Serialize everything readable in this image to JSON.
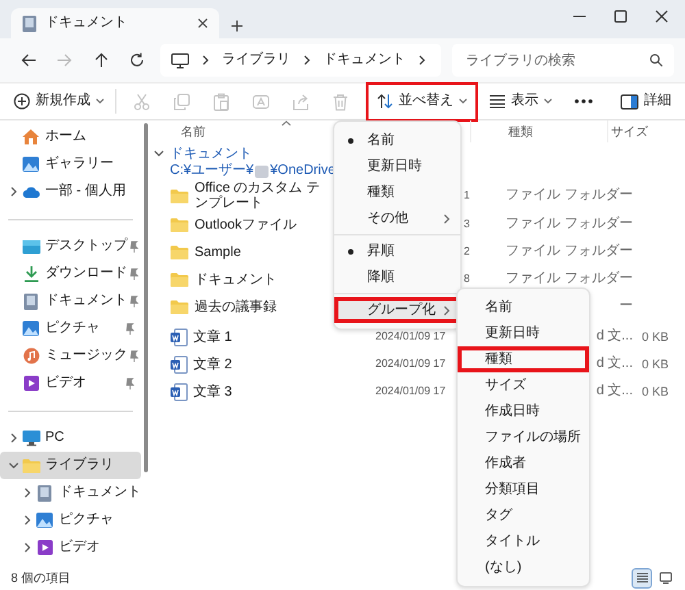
{
  "window": {
    "tab_title": "ドキュメント"
  },
  "navigation": [
    {
      "disabled": false
    },
    {
      "disabled": true
    },
    {
      "disabled": false
    },
    {
      "disabled": false
    }
  ],
  "address": {
    "segments": [
      "ライブラリ",
      "ドキュメント"
    ]
  },
  "search": {
    "placeholder": "ライブラリの検索"
  },
  "toolbar": {
    "new_label": "新規作成",
    "edit_actions": [
      {
        "disabled": true
      },
      {
        "disabled": true
      },
      {
        "disabled": true
      },
      {
        "disabled": true
      },
      {
        "disabled": true
      },
      {
        "disabled": true
      }
    ],
    "sort": {
      "label": "並べ替え",
      "highlighted": true
    },
    "view_label": "表示",
    "details_label": "詳細"
  },
  "sidebar": {
    "sections": [
      [
        {
          "label": "ホーム",
          "selected": false
        },
        {
          "label": "ギャラリー",
          "selected": false
        },
        {
          "label": "一部 - 個人用",
          "selected": false,
          "expanded": false
        }
      ],
      [
        {
          "label": "デスクトップ",
          "selected": false,
          "pinned": true
        },
        {
          "label": "ダウンロード",
          "selected": false,
          "pinned": true
        },
        {
          "label": "ドキュメント",
          "selected": false,
          "pinned": true
        },
        {
          "label": "ピクチャ",
          "selected": false,
          "pinned": true
        },
        {
          "label": "ミュージック",
          "selected": false,
          "pinned": true
        },
        {
          "label": "ビデオ",
          "selected": false,
          "pinned": true
        }
      ],
      [
        {
          "label": "PC",
          "selected": false,
          "expanded": false
        },
        {
          "label": "ライブラリ",
          "selected": true,
          "expanded": true,
          "children": [
            {
              "label": "ドキュメント",
              "selected": false,
              "expanded": false
            },
            {
              "label": "ピクチャ",
              "selected": false,
              "expanded": false
            },
            {
              "label": "ビデオ",
              "selected": false,
              "expanded": false
            }
          ]
        }
      ]
    ]
  },
  "columns": {
    "name": "名前",
    "type": "種類",
    "size": "サイズ"
  },
  "group": {
    "title": "ドキュメント",
    "expanded": true,
    "path_start": "C:¥ユーザー¥",
    "path_end": "¥OneDrive"
  },
  "rows": [
    {
      "kind": "folder",
      "name": "Office のカスタム テンプレート",
      "date": "1",
      "type": "ファイル フォルダー"
    },
    {
      "kind": "folder",
      "name": "Outlookファイル",
      "date": "3",
      "type": "ファイル フォルダー"
    },
    {
      "kind": "folder",
      "name": "Sample",
      "date": "2",
      "type": "ファイル フォルダー"
    },
    {
      "kind": "folder",
      "name": "ドキュメント",
      "date": "8",
      "type": "ファイル フォルダー"
    },
    {
      "kind": "folder",
      "name": "過去の議事録",
      "type": "ー"
    },
    {
      "kind": "file",
      "name": "文章 1",
      "date": "2024/01/09 17",
      "type": "d 文...",
      "size": "0 KB"
    },
    {
      "kind": "file",
      "name": "文章 2",
      "date": "2024/01/09 17",
      "type": "d 文...",
      "size": "0 KB"
    },
    {
      "kind": "file",
      "name": "文章 3",
      "date": "2024/01/09 17",
      "type": "d 文...",
      "size": "0 KB"
    }
  ],
  "sort_menu": {
    "sections": [
      [
        {
          "label": "名前",
          "checked": true
        },
        {
          "label": "更新日時",
          "checked": false
        },
        {
          "label": "種類",
          "checked": false
        },
        {
          "label": "その他",
          "checked": false,
          "submenu": true
        }
      ],
      [
        {
          "label": "昇順",
          "checked": true
        },
        {
          "label": "降順",
          "checked": false
        }
      ],
      [
        {
          "label": "グループ化",
          "checked": false,
          "submenu": true,
          "hovered": true,
          "highlighted": true
        }
      ]
    ]
  },
  "group_menu": {
    "items": [
      {
        "label": "名前",
        "highlighted": false
      },
      {
        "label": "更新日時",
        "highlighted": false
      },
      {
        "label": "種類",
        "highlighted": true
      },
      {
        "label": "サイズ",
        "highlighted": false
      },
      {
        "label": "作成日時",
        "highlighted": false
      },
      {
        "label": "ファイルの場所",
        "highlighted": false
      },
      {
        "label": "作成者",
        "highlighted": false
      },
      {
        "label": "分類項目",
        "highlighted": false
      },
      {
        "label": "タグ",
        "highlighted": false
      },
      {
        "label": "タイトル",
        "highlighted": false
      },
      {
        "label": "(なし)",
        "highlighted": false
      }
    ]
  },
  "status_bar": {
    "count": "8 個の項目"
  },
  "view_buttons": [
    {
      "selected": true
    },
    {
      "selected": false
    }
  ]
}
